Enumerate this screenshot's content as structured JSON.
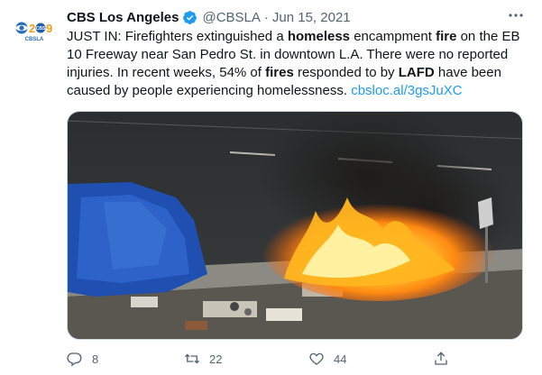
{
  "tweet": {
    "author_name": "CBS Los Angeles",
    "handle": "@CBSLA",
    "separator": "·",
    "date": "Jun 15, 2021",
    "avatar": {
      "top_text": "CBS",
      "bottom_text": "CBSLA",
      "number": "2",
      "number2": "9"
    },
    "text": {
      "p1": "JUST IN: Firefighters extinguished a ",
      "b1": "homeless",
      "p2": " encampment ",
      "b2": "fire",
      "p3": " on the EB 10 Freeway near San Pedro St. in downtown L.A. There were no reported injuries. In recent weeks, 54% of ",
      "b3": "fires",
      "p4": " responded to by ",
      "b4": "LAFD",
      "p5": " have been caused by people experiencing homelessness. ",
      "link": "cbsloc.al/3gsJuXC"
    },
    "actions": {
      "replies": "8",
      "retweets": "22",
      "likes": "44"
    },
    "icons": {
      "verified": "verified-badge-icon",
      "more": "more-icon",
      "reply": "reply-icon",
      "retweet": "retweet-icon",
      "like": "heart-icon",
      "share": "share-icon"
    },
    "colors": {
      "accent": "#1d9bf0",
      "secondary_text": "#536471",
      "text": "#0f1419"
    }
  }
}
